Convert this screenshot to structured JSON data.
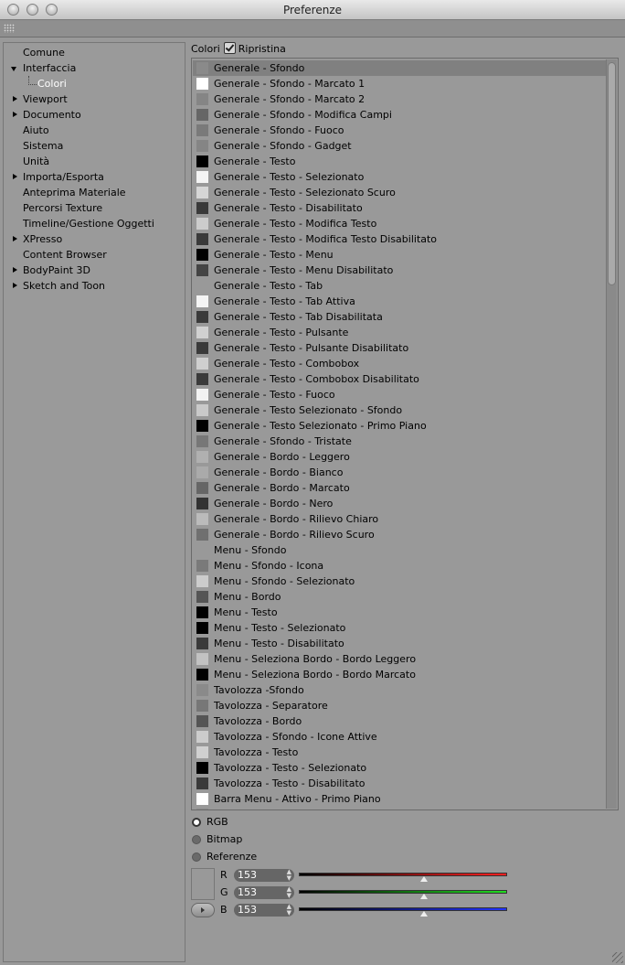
{
  "window": {
    "title": "Preferenze"
  },
  "sidebar": {
    "items": [
      {
        "label": "Comune",
        "expander": "none",
        "child": false
      },
      {
        "label": "Interfaccia",
        "expander": "open",
        "child": false
      },
      {
        "label": "Colori",
        "expander": "none",
        "child": true
      },
      {
        "label": "Viewport",
        "expander": "closed",
        "child": false
      },
      {
        "label": "Documento",
        "expander": "closed",
        "child": false
      },
      {
        "label": "Aiuto",
        "expander": "none",
        "child": false
      },
      {
        "label": "Sistema",
        "expander": "none",
        "child": false
      },
      {
        "label": "Unità",
        "expander": "none",
        "child": false
      },
      {
        "label": "Importa/Esporta",
        "expander": "closed",
        "child": false
      },
      {
        "label": "Anteprima Materiale",
        "expander": "none",
        "child": false
      },
      {
        "label": "Percorsi Texture",
        "expander": "none",
        "child": false
      },
      {
        "label": "Timeline/Gestione Oggetti",
        "expander": "none",
        "child": false
      },
      {
        "label": "XPresso",
        "expander": "closed",
        "child": false
      },
      {
        "label": "Content Browser",
        "expander": "none",
        "child": false
      },
      {
        "label": "BodyPaint 3D",
        "expander": "closed",
        "child": false
      },
      {
        "label": "Sketch and Toon",
        "expander": "closed",
        "child": false
      }
    ]
  },
  "panel": {
    "section_label": "Colori",
    "reset_label": "Ripristina"
  },
  "color_list": [
    {
      "label": "Generale - Sfondo",
      "color": "#8a8a8a",
      "selected": true
    },
    {
      "label": "Generale - Sfondo - Marcato 1",
      "color": "#ffffff"
    },
    {
      "label": "Generale - Sfondo - Marcato 2",
      "color": "#858585"
    },
    {
      "label": "Generale - Sfondo - Modifica Campi",
      "color": "#666666"
    },
    {
      "label": "Generale - Sfondo - Fuoco",
      "color": "#7a7a7a"
    },
    {
      "label": "Generale - Sfondo - Gadget",
      "color": "#858585"
    },
    {
      "label": "Generale - Testo",
      "color": "#000000"
    },
    {
      "label": "Generale - Testo - Selezionato",
      "color": "#f4f4f4"
    },
    {
      "label": "Generale - Testo - Selezionato Scuro",
      "color": "#d6d6d6"
    },
    {
      "label": "Generale - Testo - Disabilitato",
      "color": "#3a3a3a"
    },
    {
      "label": "Generale - Testo - Modifica Testo",
      "color": "#cccccc"
    },
    {
      "label": "Generale - Testo - Modifica Testo Disabilitato",
      "color": "#3a3a3a"
    },
    {
      "label": "Generale - Testo - Menu",
      "color": "#000000"
    },
    {
      "label": "Generale - Testo - Menu Disabilitato",
      "color": "#444444"
    },
    {
      "label": "Generale - Testo - Tab",
      "color": "#999999"
    },
    {
      "label": "Generale - Testo - Tab Attiva",
      "color": "#f4f4f4"
    },
    {
      "label": "Generale - Testo - Tab Disabilitata",
      "color": "#3a3a3a"
    },
    {
      "label": "Generale - Testo - Pulsante",
      "color": "#d0d0d0"
    },
    {
      "label": "Generale - Testo - Pulsante Disabilitato",
      "color": "#3a3a3a"
    },
    {
      "label": "Generale - Testo - Combobox",
      "color": "#cfcfcf"
    },
    {
      "label": "Generale - Testo - Combobox Disabilitato",
      "color": "#3a3a3a"
    },
    {
      "label": "Generale - Testo - Fuoco",
      "color": "#f2f2f2"
    },
    {
      "label": "Generale - Testo Selezionato - Sfondo",
      "color": "#c9c9c9"
    },
    {
      "label": "Generale - Testo Selezionato - Primo Piano",
      "color": "#000000"
    },
    {
      "label": "Generale - Sfondo - Tristate",
      "color": "#777777"
    },
    {
      "label": "Generale - Bordo - Leggero",
      "color": "#b0b0b0"
    },
    {
      "label": "Generale - Bordo - Bianco",
      "color": "#aaaaaa"
    },
    {
      "label": "Generale - Bordo - Marcato",
      "color": "#666666"
    },
    {
      "label": "Generale - Bordo - Nero",
      "color": "#333333"
    },
    {
      "label": "Generale - Bordo - Rilievo Chiaro",
      "color": "#bbbbbb"
    },
    {
      "label": "Generale - Bordo - Rilievo Scuro",
      "color": "#707070"
    },
    {
      "label": "Menu - Sfondo",
      "color": "#999999"
    },
    {
      "label": "Menu - Sfondo - Icona",
      "color": "#7a7a7a"
    },
    {
      "label": "Menu - Sfondo - Selezionato",
      "color": "#cccccc"
    },
    {
      "label": "Menu - Bordo",
      "color": "#555555"
    },
    {
      "label": "Menu - Testo",
      "color": "#000000"
    },
    {
      "label": "Menu - Testo - Selezionato",
      "color": "#000000"
    },
    {
      "label": "Menu - Testo - Disabilitato",
      "color": "#3a3a3a"
    },
    {
      "label": "Menu - Seleziona Bordo - Bordo Leggero",
      "color": "#c2c2c2"
    },
    {
      "label": "Menu - Seleziona Bordo - Bordo Marcato",
      "color": "#000000"
    },
    {
      "label": "Tavolozza -Sfondo",
      "color": "#8a8a8a"
    },
    {
      "label": "Tavolozza - Separatore",
      "color": "#777777"
    },
    {
      "label": "Tavolozza - Bordo",
      "color": "#555555"
    },
    {
      "label": "Tavolozza - Sfondo - Icone Attive",
      "color": "#cccccc"
    },
    {
      "label": "Tavolozza - Testo",
      "color": "#d0d0d0"
    },
    {
      "label": "Tavolozza - Testo - Selezionato",
      "color": "#000000"
    },
    {
      "label": "Tavolozza - Testo - Disabilitato",
      "color": "#3a3a3a"
    },
    {
      "label": "Barra Menu - Attivo - Primo Piano",
      "color": "#ffffff"
    },
    {
      "label": "",
      "color": "#8a8a8a"
    }
  ],
  "color_mode": {
    "options": [
      "RGB",
      "Bitmap",
      "Referenze"
    ],
    "selected": "RGB"
  },
  "rgb": {
    "channels": [
      {
        "label": "R",
        "value": "153",
        "fraction": 0.6,
        "gradient_end": "#ff2020"
      },
      {
        "label": "G",
        "value": "153",
        "fraction": 0.6,
        "gradient_end": "#22dd22"
      },
      {
        "label": "B",
        "value": "153",
        "fraction": 0.6,
        "gradient_end": "#2233ff"
      }
    ]
  }
}
